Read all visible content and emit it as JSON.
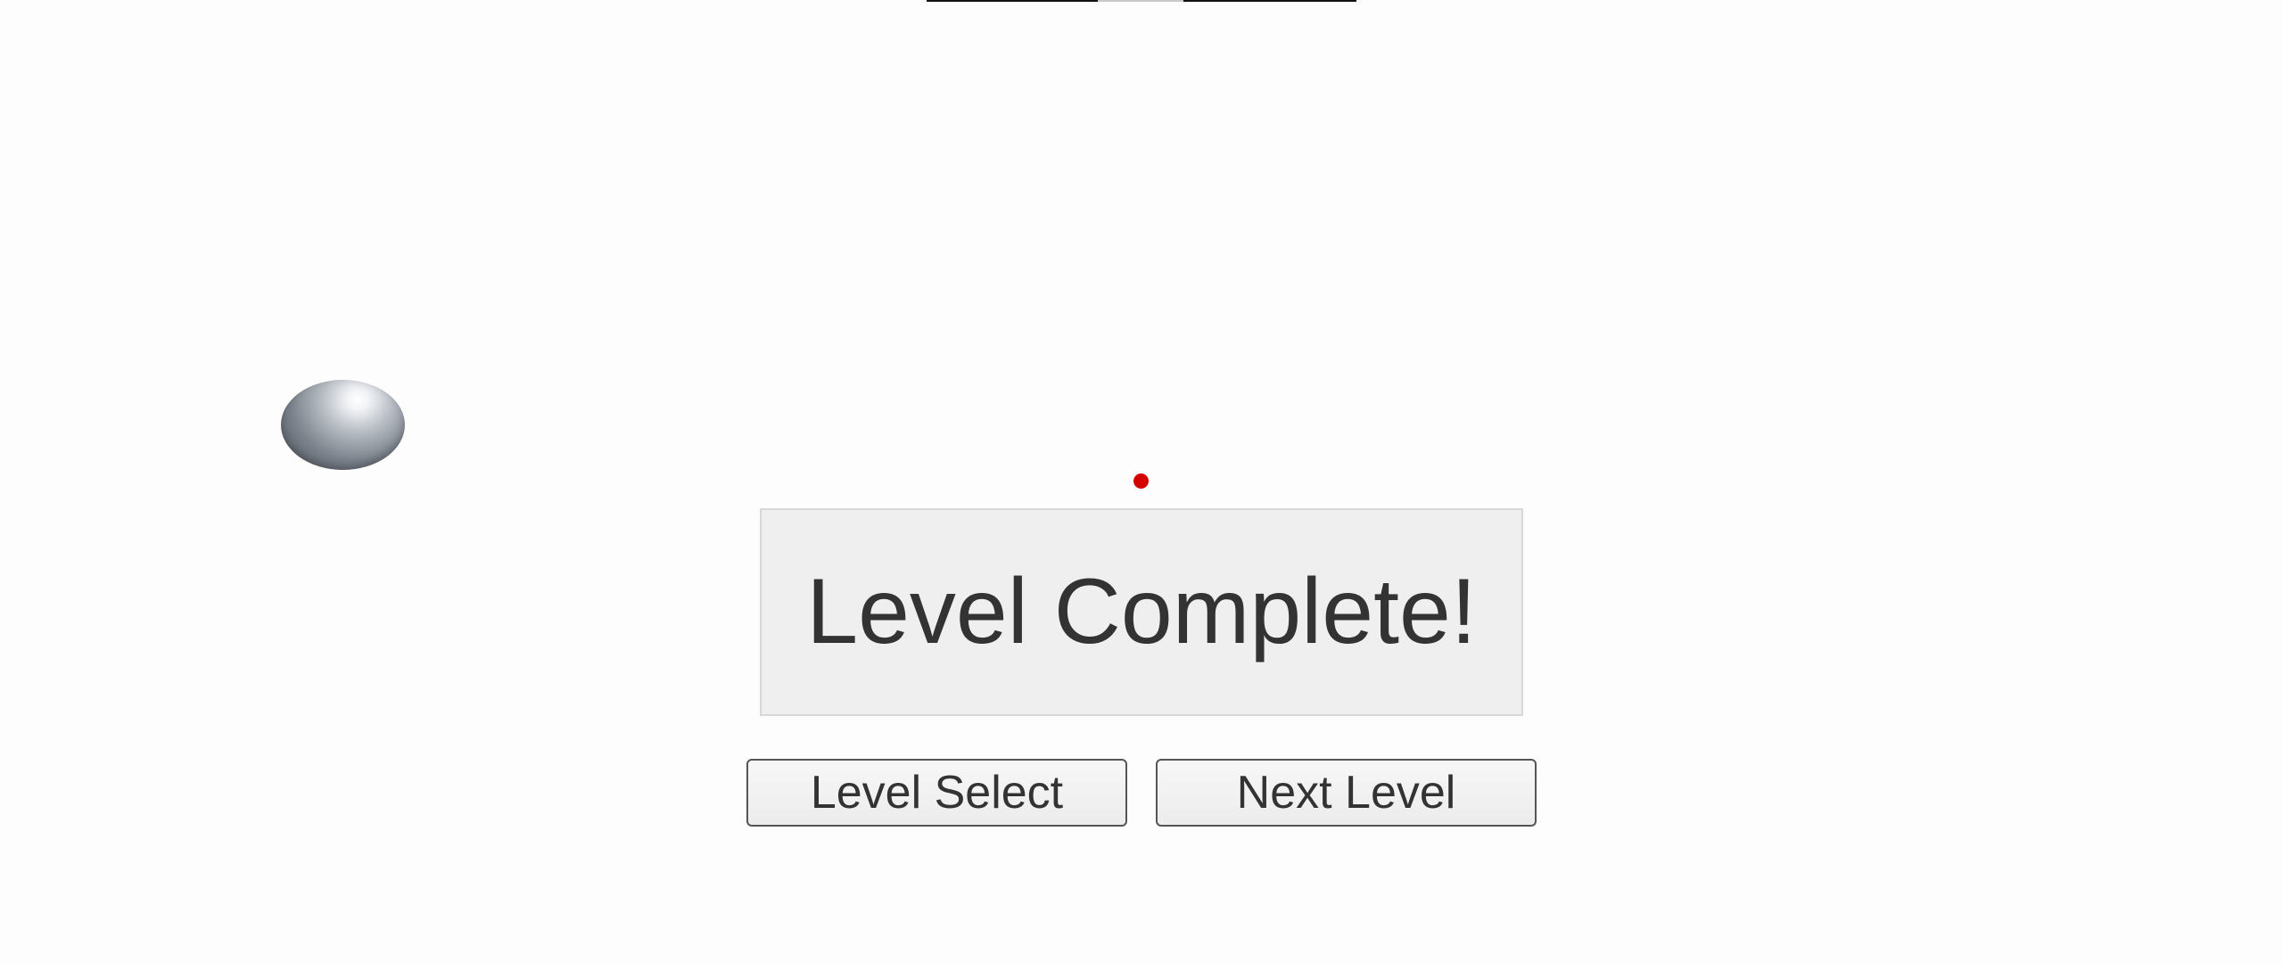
{
  "hud": {
    "progress_bar_present": true
  },
  "scene": {
    "ball_icon": "metallic-sphere",
    "target_icon": "red-dot",
    "target_color": "#d40000"
  },
  "dialog": {
    "title": "Level Complete!",
    "buttons": {
      "level_select": "Level Select",
      "next_level": "Next Level"
    }
  }
}
